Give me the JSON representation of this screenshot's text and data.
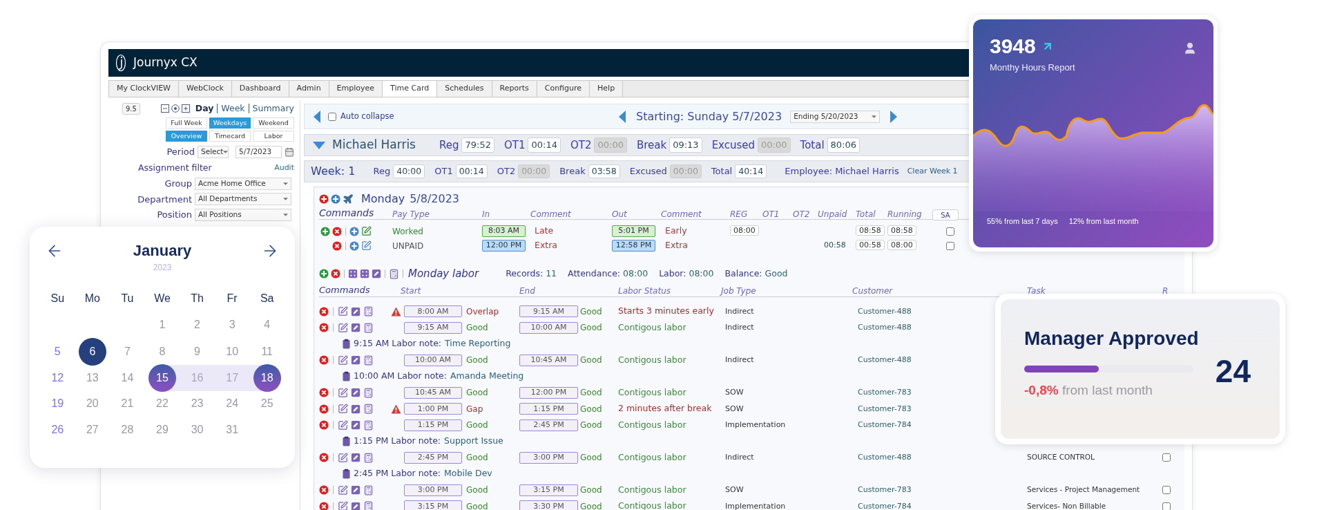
{
  "app": {
    "title": "Journyx CX",
    "menu": [
      {
        "label": "My ClockVIEW",
        "selected": false
      },
      {
        "label": "WebClock",
        "selected": false
      },
      {
        "label": "Dashboard",
        "selected": false
      },
      {
        "label": "Admin",
        "selected": false
      },
      {
        "label": "Employee",
        "selected": false
      },
      {
        "label": "Time Card",
        "selected": true
      },
      {
        "label": "Schedules",
        "selected": false
      },
      {
        "label": "Reports",
        "selected": false
      },
      {
        "label": "Configure",
        "selected": false
      },
      {
        "label": "Help",
        "selected": false
      }
    ],
    "sidebar": {
      "version": "9.5",
      "views": [
        {
          "label": "Day",
          "selected": true
        },
        {
          "label": "Week",
          "selected": false
        },
        {
          "label": "Summary",
          "selected": false
        }
      ],
      "ranges": [
        {
          "label": "Full Week",
          "selected": false
        },
        {
          "label": "Weekdays",
          "selected": true
        },
        {
          "label": "Weekend",
          "selected": false
        }
      ],
      "modes": [
        {
          "label": "Overview",
          "selected": true
        },
        {
          "label": "Timecard",
          "selected": false
        },
        {
          "label": "Labor",
          "selected": false
        }
      ],
      "period": {
        "label": "Period",
        "select": "Select",
        "date": "5/7/2023"
      },
      "assignment_filter": "Assignment filter",
      "audit": "Audit",
      "filters": [
        {
          "label": "Group",
          "value": "Acme Home Office"
        },
        {
          "label": "Department",
          "value": "All Departments"
        },
        {
          "label": "Position",
          "value": "All Positions"
        }
      ]
    },
    "navigator": {
      "auto_collapse": {
        "label": "Auto collapse",
        "checked": false
      },
      "starting": "Starting: Sunday 5/7/2023",
      "ending": "Ending 5/20/2023"
    },
    "employee_bar": {
      "expanded": true,
      "name": "Michael Harris",
      "totals": [
        {
          "label": "Reg",
          "value": "79:52",
          "disabled": false
        },
        {
          "label": "OT1",
          "value": "00:14",
          "disabled": false
        },
        {
          "label": "OT2",
          "value": "00:00",
          "disabled": true
        },
        {
          "label": "Break",
          "value": "09:13",
          "disabled": false
        },
        {
          "label": "Excused",
          "value": "00:00",
          "disabled": true
        },
        {
          "label": "Total",
          "value": "80:06",
          "disabled": false
        }
      ]
    },
    "week_bar": {
      "label": "Week: 1",
      "totals": [
        {
          "label": "Reg",
          "value": "40:00",
          "disabled": false
        },
        {
          "label": "OT1",
          "value": "00:14",
          "disabled": false
        },
        {
          "label": "OT2",
          "value": "00:00",
          "disabled": true
        },
        {
          "label": "Break",
          "value": "03:58",
          "disabled": false
        },
        {
          "label": "Excused",
          "value": "00:00",
          "disabled": true
        },
        {
          "label": "Total",
          "value": "40:14",
          "disabled": false
        }
      ],
      "employee": "Employee: Michael Harris",
      "clear": "Clear Week 1"
    },
    "day": {
      "weekday": "Monday",
      "date": "5/8/2023",
      "columns": [
        "Commands",
        "Pay Type",
        "In",
        "Comment",
        "Out",
        "Comment",
        "REG",
        "OT1",
        "OT2",
        "Unpaid",
        "Total",
        "Running"
      ],
      "column_button": "SA",
      "rows": [
        {
          "kind": "worked",
          "add_icon": true,
          "pay_type": "Worked",
          "in": "8:03 AM",
          "in_comment": "Late",
          "out": "5:01 PM",
          "out_comment": "Early",
          "reg": "08:00",
          "total": "08:58",
          "running": "08:58",
          "checked": false
        },
        {
          "kind": "unpaid",
          "add_icon": false,
          "pay_type": "UNPAID",
          "in": "12:00 PM",
          "in_comment": "Extra",
          "out": "12:58 PM",
          "out_comment": "Extra",
          "unpaid": "00:58",
          "total": "00:58",
          "running": "08:00",
          "checked": false
        }
      ]
    },
    "labor": {
      "title": "Monday labor",
      "stats": [
        {
          "label": "Records:",
          "value": "11"
        },
        {
          "label": "Attendance:",
          "value": "08:00"
        },
        {
          "label": "Labor:",
          "value": "08:00"
        },
        {
          "label": "Balance:",
          "value": "Good"
        }
      ],
      "columns": [
        "Commands",
        "Start",
        "End",
        "Labor Status",
        "Job Type",
        "Customer",
        "Task",
        "R"
      ],
      "rows": [
        {
          "kind": "entry",
          "warning": true,
          "start": "8:00 AM",
          "start_status": "Overlap",
          "start_ok": false,
          "end": "9:15 AM",
          "end_status": "Good",
          "end_ok": true,
          "status": "Starts 3 minutes early",
          "status_ok": false,
          "job_type": "Indirect",
          "customer": "Customer-488"
        },
        {
          "kind": "entry",
          "warning": false,
          "start": "9:15 AM",
          "start_status": "Good",
          "start_ok": true,
          "end": "10:00 AM",
          "end_status": "Good",
          "end_ok": true,
          "status": "Contigous labor",
          "status_ok": true,
          "job_type": "Indirect",
          "customer": "Customer-488"
        },
        {
          "kind": "note",
          "time": "9:15 AM Labor note:",
          "text": "Time Reporting"
        },
        {
          "kind": "entry",
          "warning": false,
          "start": "10:00 AM",
          "start_status": "Good",
          "start_ok": true,
          "end": "10:45 AM",
          "end_status": "Good",
          "end_ok": true,
          "status": "Contigous labor",
          "status_ok": true,
          "job_type": "Indirect",
          "customer": "Customer-488"
        },
        {
          "kind": "note",
          "time": "10:00 AM Labor note:",
          "text": "Amanda Meeting"
        },
        {
          "kind": "entry",
          "warning": false,
          "start": "10:45 AM",
          "start_status": "Good",
          "start_ok": true,
          "end": "12:00 PM",
          "end_status": "Good",
          "end_ok": true,
          "status": "Contigous labor",
          "status_ok": true,
          "job_type": "SOW",
          "customer": "Customer-783"
        },
        {
          "kind": "entry",
          "warning": true,
          "start": "1:00 PM",
          "start_status": "Gap",
          "start_ok": false,
          "end": "1:15 PM",
          "end_status": "Good",
          "end_ok": true,
          "status": "2 minutes after break",
          "status_ok": false,
          "job_type": "SOW",
          "customer": "Customer-783"
        },
        {
          "kind": "entry",
          "warning": false,
          "start": "1:15 PM",
          "start_status": "Good",
          "start_ok": true,
          "end": "2:45 PM",
          "end_status": "Good",
          "end_ok": true,
          "status": "Contigous labor",
          "status_ok": true,
          "job_type": "Implementation",
          "customer": "Customer-784"
        },
        {
          "kind": "note",
          "time": "1:15 PM Labor note:",
          "text": "Support Issue"
        },
        {
          "kind": "entry",
          "warning": false,
          "start": "2:45 PM",
          "start_status": "Good",
          "start_ok": true,
          "end": "3:00 PM",
          "end_status": "Good",
          "end_ok": true,
          "status": "Contigous labor",
          "status_ok": true,
          "job_type": "Indirect",
          "customer": "Customer-488",
          "task": "SOURCE CONTROL",
          "checked": false
        },
        {
          "kind": "note",
          "time": "2:45 PM Labor note:",
          "text": "Mobile Dev"
        },
        {
          "kind": "entry",
          "warning": false,
          "start": "3:00 PM",
          "start_status": "Good",
          "start_ok": true,
          "end": "3:15 PM",
          "end_status": "Good",
          "end_ok": true,
          "status": "Contigous labor",
          "status_ok": true,
          "job_type": "SOW",
          "customer": "Customer-783",
          "task": "Services - Project Management",
          "checked": false
        },
        {
          "kind": "entry",
          "warning": false,
          "start": "3:15 PM",
          "start_status": "Good",
          "start_ok": true,
          "end": "3:30 PM",
          "end_status": "Good",
          "end_ok": true,
          "status": "Contigous labor",
          "status_ok": true,
          "job_type": "Implementation",
          "customer": "Customer-784",
          "task": "Services- Non Billable",
          "checked": false
        }
      ]
    }
  },
  "calendar": {
    "month": "January",
    "year": "2023",
    "weekdays": [
      "Su",
      "Mo",
      "Tu",
      "We",
      "Th",
      "Fr",
      "Sa"
    ],
    "weeks": [
      [
        {
          "label": "1",
          "kind": "plain"
        },
        {
          "label": "2",
          "kind": "plain"
        },
        {
          "label": "3",
          "kind": "plain"
        },
        {
          "label": "4",
          "kind": "plain"
        }
      ],
      [
        {
          "label": "5",
          "kind": "plain"
        },
        {
          "label": "6",
          "kind": "selected"
        },
        {
          "label": "7",
          "kind": "plain"
        },
        {
          "label": "8",
          "kind": "plain"
        },
        {
          "label": "9",
          "kind": "plain"
        },
        {
          "label": "10",
          "kind": "plain"
        },
        {
          "label": "11",
          "kind": "plain"
        }
      ],
      [
        {
          "label": "12",
          "kind": "plain"
        },
        {
          "label": "13",
          "kind": "plain"
        },
        {
          "label": "14",
          "kind": "plain"
        },
        {
          "label": "15",
          "kind": "range_start"
        },
        {
          "label": "16",
          "kind": "in_range"
        },
        {
          "label": "17",
          "kind": "in_range"
        },
        {
          "label": "18",
          "kind": "range_end"
        }
      ],
      [
        {
          "label": "19",
          "kind": "plain"
        },
        {
          "label": "20",
          "kind": "plain"
        },
        {
          "label": "21",
          "kind": "plain"
        },
        {
          "label": "22",
          "kind": "plain"
        },
        {
          "label": "23",
          "kind": "plain"
        },
        {
          "label": "24",
          "kind": "plain"
        },
        {
          "label": "25",
          "kind": "plain"
        }
      ],
      [
        {
          "label": "26",
          "kind": "plain"
        },
        {
          "label": "27",
          "kind": "plain"
        },
        {
          "label": "28",
          "kind": "plain"
        },
        {
          "label": "29",
          "kind": "plain"
        },
        {
          "label": "30",
          "kind": "plain"
        },
        {
          "label": "31",
          "kind": "plain"
        }
      ]
    ]
  },
  "hours_card": {
    "value": "3948",
    "title": "Monthy Hours Report",
    "stats": [
      "55% from last 7 days",
      "12% from last month"
    ]
  },
  "approval_card": {
    "title": "Manager Approved",
    "level": 0.44,
    "count": "24",
    "change": "-0,8%",
    "change_text": "from last month"
  }
}
